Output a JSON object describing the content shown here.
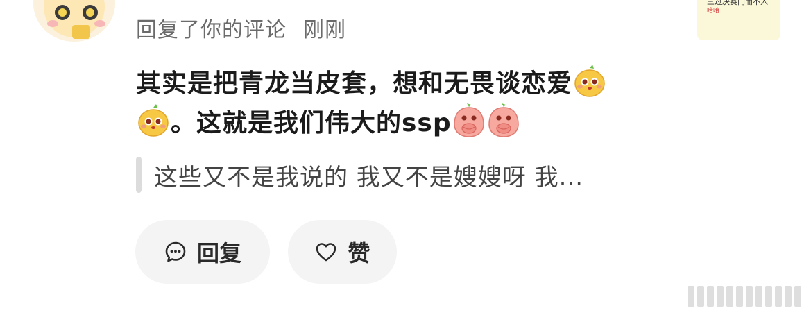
{
  "comment": {
    "meta_text": "回复了你的评论",
    "time": "刚刚",
    "content_part1": "其实是把青龙当皮套，想和无畏谈恋爱",
    "content_part2": "。这就是我们伟大的ssp",
    "emojis": [
      "yellow-mango-emoji",
      "yellow-mango-emoji",
      "peach-cover-mouth-emoji",
      "peach-cover-mouth-emoji"
    ],
    "quote": "这些又不是我说的 我又不是嫂嫂呀 我..."
  },
  "thumbnail": {
    "line1": "三过决赛门而不入",
    "line2": "哈哈"
  },
  "actions": {
    "reply_label": "回复",
    "like_label": "赞"
  },
  "colors": {
    "meta_text": "#6b6b6b",
    "button_bg": "#f4f4f4",
    "quote_bar": "#dcdcdc",
    "thumbnail_bg": "#fbf8da"
  }
}
